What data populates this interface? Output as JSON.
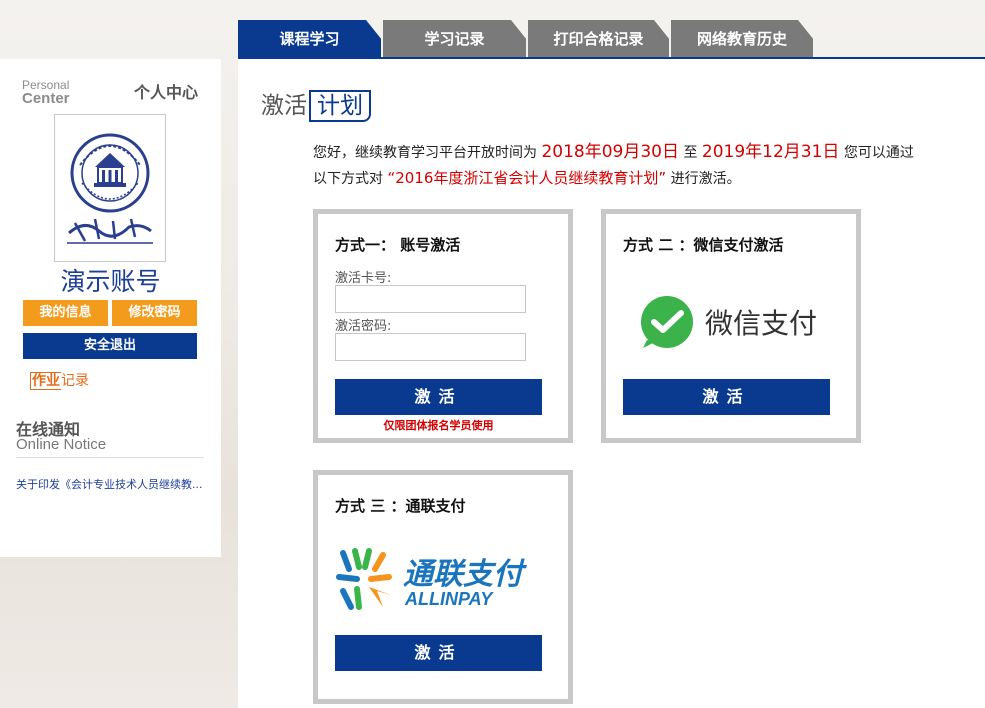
{
  "tabs": [
    {
      "label": "课程学习"
    },
    {
      "label": "学习记录"
    },
    {
      "label": "打印合格记录"
    },
    {
      "label": "网络教育历史"
    }
  ],
  "sidebar": {
    "personal_en_1": "Personal",
    "personal_en_2": "Center",
    "personal_cn": "个人中心",
    "username": "演示账号",
    "my_info": "我的信息",
    "change_password": "修改密码",
    "logout": "安全退出",
    "homework_prefix": "作业",
    "homework_suffix": "记录",
    "notice_cn": "在线通知",
    "notice_en": "Online Notice",
    "notice_item": "关于印发《会计专业技术人员继续教..."
  },
  "main": {
    "heading_prefix": "激活",
    "heading_box": "计划",
    "intro": {
      "p1": "您好，继续教育学习平台开放时间为",
      "date_start": "2018年09月30日",
      "to": "至",
      "date_end": "2019年12月31日",
      "p2": "您可以通过以下方式对",
      "plan": "“2016年度浙江省会计人员继续教育计划”",
      "p3": "进行激活。"
    },
    "method1": {
      "title": "方式一： 账号激活",
      "card_label": "激活卡号:",
      "card_value": "",
      "pwd_label": "激活密码:",
      "pwd_value": "",
      "button": "激活",
      "note": "仅限团体报名学员使用"
    },
    "method2": {
      "title": "方式 二 ：微信支付激活",
      "logo_text": "微信支付",
      "button": "激活"
    },
    "method3": {
      "title": "方式 三 ：通联支付",
      "logo_cn": "通联支付",
      "logo_en": "ALLINPAY",
      "button": "激活"
    }
  },
  "colors": {
    "brand_blue": "#0a3a8f",
    "tab_gray": "#7a7a7a",
    "orange": "#f39b1d",
    "red": "#d40000",
    "wechat_green": "#3bb34a"
  }
}
